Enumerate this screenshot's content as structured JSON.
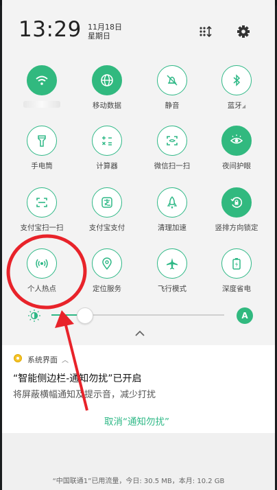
{
  "header": {
    "time": "13:29",
    "date": "11月18日",
    "weekday": "星期日",
    "grid_icon": "edit-grid-icon",
    "settings_icon": "gear-icon"
  },
  "tiles": [
    {
      "label": "",
      "icon": "wifi-icon",
      "active": true
    },
    {
      "label": "移动数据",
      "icon": "globe-icon",
      "active": false
    },
    {
      "label": "静音",
      "icon": "bell-mute-icon",
      "active": false
    },
    {
      "label": "蓝牙",
      "icon": "bluetooth-icon",
      "active": false
    },
    {
      "label": "手电筒",
      "icon": "flashlight-icon",
      "active": false
    },
    {
      "label": "计算器",
      "icon": "calculator-icon",
      "active": false
    },
    {
      "label": "微信扫一扫",
      "icon": "scan-icon",
      "active": false
    },
    {
      "label": "夜间护眼",
      "icon": "eye-icon",
      "active": true
    },
    {
      "label": "支付宝扫一扫",
      "icon": "alipay-scan-icon",
      "active": false
    },
    {
      "label": "支付宝支付",
      "icon": "alipay-icon",
      "active": false
    },
    {
      "label": "清理加速",
      "icon": "rocket-icon",
      "active": false
    },
    {
      "label": "竖排方向锁定",
      "icon": "rotation-lock-icon",
      "active": true
    },
    {
      "label": "个人热点",
      "icon": "hotspot-icon",
      "active": false
    },
    {
      "label": "定位服务",
      "icon": "location-icon",
      "active": false
    },
    {
      "label": "飞行模式",
      "icon": "airplane-icon",
      "active": false
    },
    {
      "label": "深度省电",
      "icon": "battery-saver-icon",
      "active": false
    }
  ],
  "brightness": {
    "level_fraction": 0.19,
    "auto_label": "A"
  },
  "notification": {
    "app": "系统界面",
    "title": "“智能侧边栏-通知勿扰”已开启",
    "body": "将屏蔽横幅通知及提示音，减少打扰",
    "action": "取消“通知勿扰”"
  },
  "footer": {
    "data_usage": "“中国联通1”已用流量，今日: 30.5 MB，本月: 10.2 GB"
  },
  "colors": {
    "accent": "#2eb886",
    "annotation": "#e8232a"
  }
}
